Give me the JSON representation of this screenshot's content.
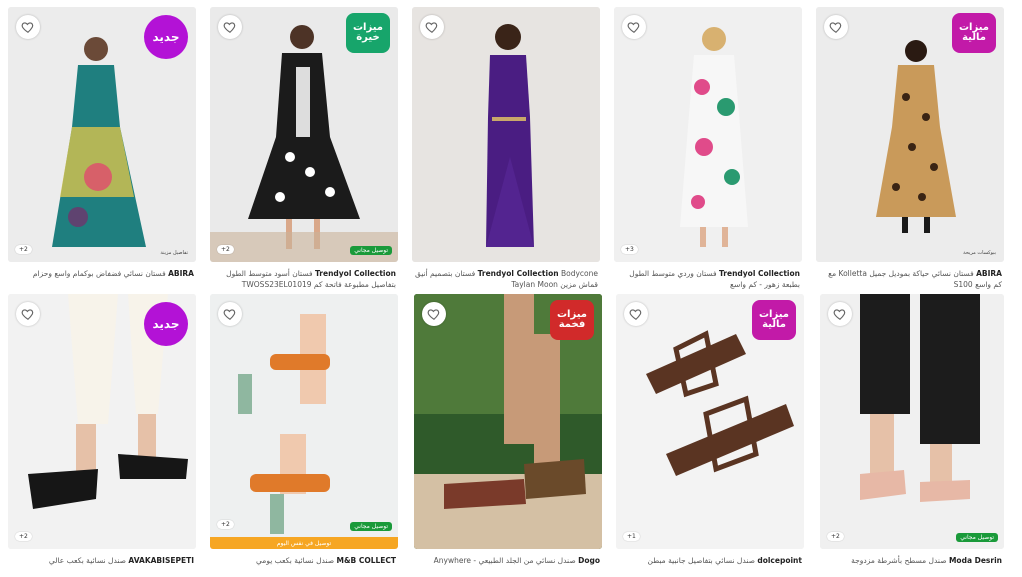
{
  "products": [
    {
      "brand": "ABIRA",
      "title": "فستان نسائي فضفاض بوكمام واسع وحزام",
      "badge": "جديد",
      "badge_type": "new",
      "count": "+2",
      "ship": "",
      "caption": "تفاصيل مزينة",
      "strip": ""
    },
    {
      "brand": "Trendyol Collection",
      "title": "فستان أسود متوسط الطول بتفاصيل مطبوعة فاتحة كم TWOSS23EL01019",
      "badge": "ميزات خيرة",
      "badge_type": "deal",
      "badge_color": "#17a56b",
      "count": "+2",
      "ship": "توصيل مجاني",
      "caption": "",
      "strip": ""
    },
    {
      "brand": "Trendyol Collection",
      "title": "Bodycone فستان بتصميم أنيق قماش مزين Taylan Moon",
      "badge": "",
      "badge_type": "",
      "count": "",
      "ship": "",
      "caption": "",
      "strip": ""
    },
    {
      "brand": "Trendyol Collection",
      "title": "فستان وردي متوسط الطول بطبعة زهور - كم واسع",
      "badge": "",
      "badge_type": "",
      "count": "+3",
      "ship": "",
      "caption": "",
      "strip": ""
    },
    {
      "brand": "ABIRA",
      "title": "فستان نسائي حياكة بموديل جميل Kolletta مع كم واسع S100",
      "badge": "ميزات مالية",
      "badge_type": "deal",
      "badge_color": "#c21aa8",
      "count": "",
      "ship": "",
      "caption": "ببوكسات مريحة",
      "strip": ""
    },
    {
      "brand": "AVAKABISEPETI",
      "title": "صندل نسائية بكعب عالي",
      "badge": "جديد",
      "badge_type": "new",
      "count": "+2",
      "ship": "",
      "caption": "",
      "strip": ""
    },
    {
      "brand": "M&B COLLECT",
      "title": "صندل نسائية بكعب يومي",
      "badge": "",
      "badge_type": "",
      "count": "+2",
      "ship": "توصيل مجاني",
      "caption": "",
      "strip": "توصيل في نفس اليوم"
    },
    {
      "brand": "Dogo",
      "title": "صندل نسائي من الجلد الطبيعي - Anywhere",
      "badge": "ميزات فخمة",
      "badge_type": "deal",
      "badge_color": "#d12a2a",
      "count": "",
      "ship": "",
      "caption": "",
      "strip": ""
    },
    {
      "brand": "dolcepoint",
      "title": "صندل نسائي بتفاصيل جانبية مبطن",
      "badge": "ميزات مالية",
      "badge_type": "deal",
      "badge_color": "#c21aa8",
      "count": "+1",
      "ship": "",
      "caption": "",
      "strip": ""
    },
    {
      "brand": "Moda Desrin",
      "title": "صندل مسطح بأشرطة مزدوجة",
      "badge": "",
      "badge_type": "",
      "count": "+2",
      "ship": "توصيل مجاني",
      "caption": "",
      "strip": ""
    }
  ],
  "colors": {
    "accent_purple": "#b312d6",
    "ship_green": "#1a9a3a",
    "strip_orange": "#f6a623"
  },
  "icons": {
    "heart": "heart-outline-icon"
  }
}
